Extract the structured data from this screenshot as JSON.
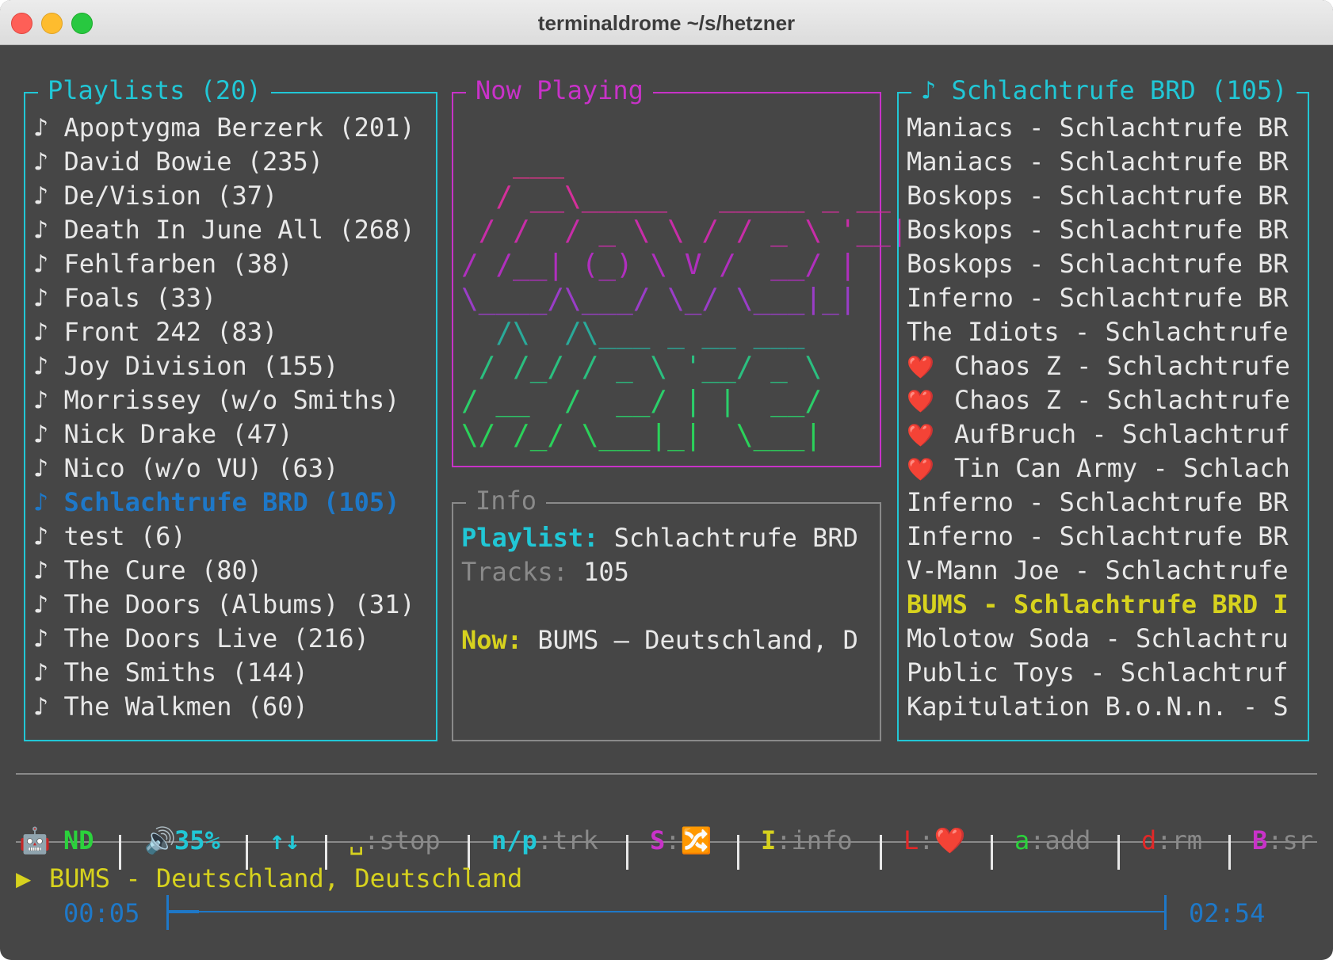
{
  "window": {
    "title": "terminaldrome ~/s/hetzner"
  },
  "playlists": {
    "title": "Playlists (20)",
    "items": [
      {
        "label": "♪ Apoptygma Berzerk (201)"
      },
      {
        "label": "♪ David Bowie (235)"
      },
      {
        "label": "♪ De/Vision (37)"
      },
      {
        "label": "♪ Death In June All (268)"
      },
      {
        "label": "♪ Fehlfarben (38)"
      },
      {
        "label": "♪ Foals (33)"
      },
      {
        "label": "♪ Front 242 (83)"
      },
      {
        "label": "♪ Joy Division (155)"
      },
      {
        "label": "♪ Morrissey (w/o Smiths)"
      },
      {
        "label": "♪ Nick Drake (47)"
      },
      {
        "label": "♪ Nico (w/o VU) (63)"
      },
      {
        "label": "♪ Schlachtrufe BRD (105)",
        "selected": true
      },
      {
        "label": "♪ test (6)"
      },
      {
        "label": "♪ The Cure (80)"
      },
      {
        "label": "♪ The Doors (Albums) (31)"
      },
      {
        "label": "♪ The Doors Live (216)"
      },
      {
        "label": "♪ The Smiths (144)"
      },
      {
        "label": "♪ The Walkmen (60)"
      }
    ]
  },
  "now_playing": {
    "title": "Now Playing",
    "logo_top": [
      "   ___",
      "  / __\\_____   _____ _ __",
      " / /  / _ \\ \\ / / _ \\ '__|",
      "/ /__| (_) \\ V /  __/ |",
      "\\____/\\___/ \\_/ \\___|_|"
    ],
    "logo_bottom": [
      "  /\\  /\\___ _ __ ___",
      " / /_/ / _ \\ '__/ _ \\",
      "/ __  /  __/ | |  __/",
      "\\/ /_/ \\___|_|  \\___|"
    ]
  },
  "info": {
    "title": "Info",
    "playlist_label": "Playlist:",
    "playlist_value": "Schlachtrufe BRD",
    "tracks_label": "Tracks:",
    "tracks_value": "105",
    "now_label": "Now:",
    "now_value": "BUMS – Deutschland, D"
  },
  "tracks": {
    "title": "♪ Schlachtrufe BRD (105)",
    "items": [
      {
        "label": "Maniacs - Schlachtrufe BR"
      },
      {
        "label": "Maniacs - Schlachtrufe BR"
      },
      {
        "label": "Boskops - Schlachtrufe BR"
      },
      {
        "label": "Boskops - Schlachtrufe BR"
      },
      {
        "label": "Boskops - Schlachtrufe BR"
      },
      {
        "label": "Inferno - Schlachtrufe BR"
      },
      {
        "label": "The Idiots - Schlachtrufe"
      },
      {
        "label": "Chaos Z - Schlachtrufe",
        "loved": true
      },
      {
        "label": "Chaos Z - Schlachtrufe",
        "loved": true
      },
      {
        "label": "AufBruch - Schlachtruf",
        "loved": true
      },
      {
        "label": "Tin Can Army - Schlach",
        "loved": true
      },
      {
        "label": "Inferno - Schlachtrufe BR"
      },
      {
        "label": "Inferno - Schlachtrufe BR"
      },
      {
        "label": "V-Mann Joe - Schlachtrufe"
      },
      {
        "label": "BUMS - Schlachtrufe BRD I",
        "playing": true
      },
      {
        "label": "Molotow Soda - Schlachtru"
      },
      {
        "label": "Public Toys - Schlachtruf"
      },
      {
        "label": "Kapitulation B.o.N.n. - S"
      }
    ],
    "heart": "❤️"
  },
  "status": {
    "robot": "🤖",
    "nd": "ND",
    "speaker": "🔊",
    "volume": "35%",
    "arrows": "↑↓",
    "stop_key": "␣",
    "stop_label": ":stop",
    "trk_key": "n/p",
    "trk_label": ":trk",
    "shuffle_key": "S",
    "colon": ":",
    "shuffle_icon": "🔀",
    "info_key": "I",
    "info_label": ":info",
    "love_key": "L",
    "love_icon": "❤️",
    "add_key": "a",
    "add_label": ":add",
    "rm_key": "d",
    "rm_label": ":rm",
    "sr_key": "B",
    "sr_label": ":sr"
  },
  "player": {
    "play_icon": "▶",
    "track": "BUMS - Deutschland, Deutschland",
    "elapsed": "00:05",
    "total": "02:54",
    "progress": 0.03
  },
  "colors": {
    "cyan": "#21c7d6",
    "magenta": "#c832c8",
    "blue": "#1e78c8",
    "yellow": "#d7d21e",
    "green": "#2bd23c",
    "red": "#e22828"
  }
}
